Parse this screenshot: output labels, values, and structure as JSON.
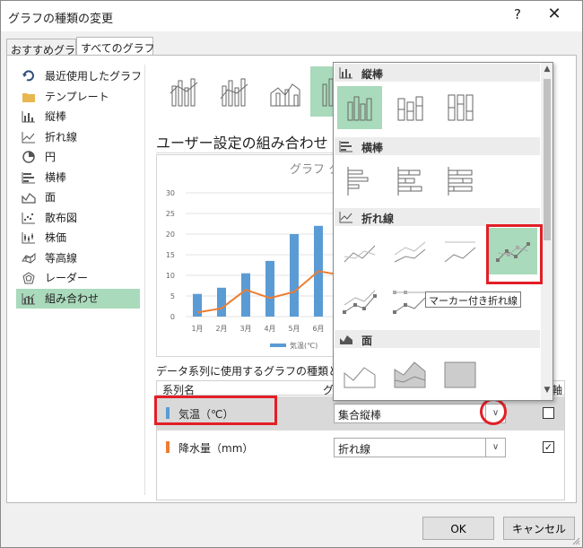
{
  "dialog": {
    "title": "グラフの種類の変更",
    "help_label": "?",
    "close_label": "✕"
  },
  "tabs": [
    {
      "label": "おすすめグラフ",
      "active": false
    },
    {
      "label": "すべてのグラフ",
      "active": true
    }
  ],
  "chart_types": [
    {
      "label": "最近使用したグラフ",
      "icon": "recent-icon",
      "active": false
    },
    {
      "label": "テンプレート",
      "icon": "folder-icon",
      "active": false
    },
    {
      "label": "縦棒",
      "icon": "column-chart-icon",
      "active": false
    },
    {
      "label": "折れ線",
      "icon": "line-chart-icon",
      "active": false
    },
    {
      "label": "円",
      "icon": "pie-chart-icon",
      "active": false
    },
    {
      "label": "横棒",
      "icon": "bar-chart-icon",
      "active": false
    },
    {
      "label": "面",
      "icon": "area-chart-icon",
      "active": false
    },
    {
      "label": "散布図",
      "icon": "scatter-chart-icon",
      "active": false
    },
    {
      "label": "株価",
      "icon": "stock-chart-icon",
      "active": false
    },
    {
      "label": "等高線",
      "icon": "surface-chart-icon",
      "active": false
    },
    {
      "label": "レーダー",
      "icon": "radar-chart-icon",
      "active": false
    },
    {
      "label": "組み合わせ",
      "icon": "combo-chart-icon",
      "active": true
    }
  ],
  "combo_section": {
    "title": "ユーザー設定の組み合わせ",
    "series_table_label": "データ系列に使用するグラフの種類と軸を選",
    "col_series": "系列名",
    "col_type": "グラ",
    "col_axis": "軸",
    "series": [
      {
        "name": "気温（℃）",
        "color": "#5b9bd5",
        "chart_type": "集合縦棒",
        "secondary_axis": false
      },
      {
        "name": "降水量（mm）",
        "color": "#ed7d31",
        "chart_type": "折れ線",
        "secondary_axis": true
      }
    ]
  },
  "chart_data": {
    "type": "bar",
    "title": "グラフ タ",
    "categories": [
      "1月",
      "2月",
      "3月",
      "4月",
      "5月",
      "6月"
    ],
    "series": [
      {
        "name": "気温(℃)",
        "type": "bar",
        "color": "#5b9bd5",
        "values": [
          5.5,
          7,
          10.5,
          13.5,
          20,
          22
        ]
      },
      {
        "name": "降水量",
        "type": "line",
        "color": "#ed7d31",
        "values": [
          1,
          2,
          6.5,
          4.5,
          6,
          11
        ]
      }
    ],
    "yticks": [
      "0",
      "5",
      "10",
      "15",
      "20",
      "25",
      "30"
    ],
    "ylim": [
      0,
      30
    ],
    "legend_visible": "気温(℃)",
    "grid": true
  },
  "popup": {
    "categories": [
      {
        "label": "縦棒",
        "icon": "column-chart-icon"
      },
      {
        "label": "横棒",
        "icon": "bar-chart-icon"
      },
      {
        "label": "折れ線",
        "icon": "line-chart-icon"
      },
      {
        "label": "面",
        "icon": "area-chart-icon"
      }
    ],
    "tooltip": "マーカー付き折れ線"
  },
  "buttons": {
    "ok": "OK",
    "cancel": "キャンセル"
  }
}
